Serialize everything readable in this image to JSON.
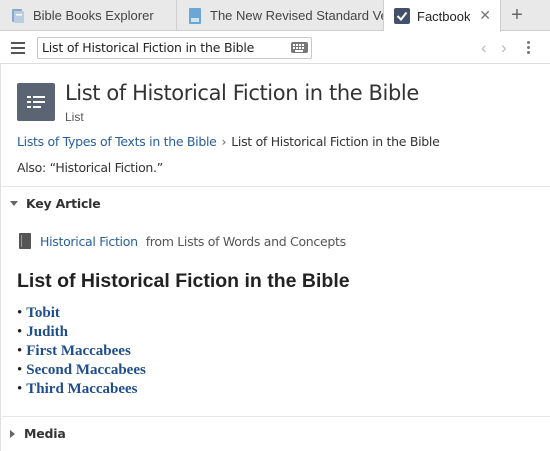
{
  "tabs": [
    {
      "label": "Bible Books Explorer",
      "icon": "bible-books-explorer-icon"
    },
    {
      "label": "The New Revised Standard Version",
      "icon": "bible-resource-icon"
    },
    {
      "label": "Factbook",
      "icon": "factbook-check-icon",
      "active": true,
      "close": "✕"
    }
  ],
  "new_tab_label": "+",
  "toolbar": {
    "address_value": "List of Historical Fiction in the Bible",
    "back": "‹",
    "forward": "›"
  },
  "header": {
    "title": "List of Historical Fiction in the Bible",
    "subtitle": "List"
  },
  "breadcrumb": {
    "parent": "Lists of Types of Texts in the Bible",
    "separator": "›",
    "current": "List of Historical Fiction in the Bible"
  },
  "also": "Also: “Historical Fiction.”",
  "key_article": {
    "section_label": "Key Article",
    "link": "Historical Fiction",
    "from": "from Lists of Words and Concepts"
  },
  "list": {
    "heading": "List of Historical Fiction in the Bible",
    "bullet": "•",
    "items": [
      "Tobit",
      "Judith",
      "First Maccabees",
      "Second Maccabees",
      "Third Maccabees"
    ]
  },
  "media": {
    "section_label": "Media"
  },
  "colors": {
    "link": "#2a6099",
    "list_link": "#1f4e8c",
    "header_icon_bg": "#5b6472",
    "tab_bar_bg": "#e9e9e9"
  }
}
